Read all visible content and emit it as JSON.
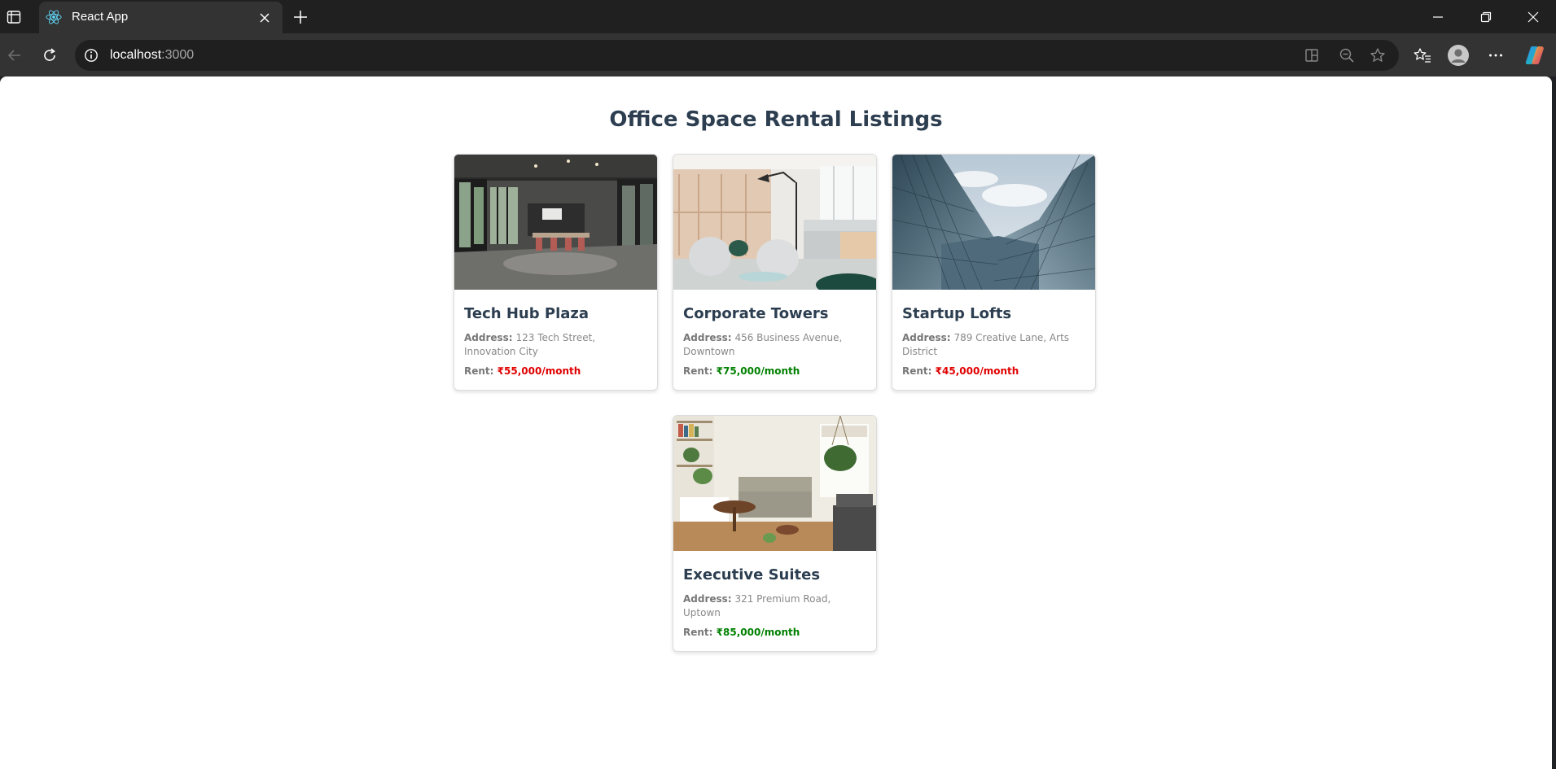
{
  "browser": {
    "tab_title": "React App",
    "url_host": "localhost",
    "url_port": ":3000",
    "icons": [
      "sidebar-toggle-icon",
      "react-logo-icon",
      "close-icon",
      "plus-icon",
      "minimize-icon",
      "restore-icon",
      "back-icon",
      "refresh-icon",
      "info-icon",
      "app-available-icon",
      "zoom-out-icon",
      "star-icon",
      "favorites-icon",
      "profile-icon",
      "more-icon",
      "copilot-icon"
    ]
  },
  "page": {
    "title": "Office Space Rental Listings"
  },
  "labels": {
    "address": "Address:",
    "rent": "Rent:"
  },
  "listings": [
    {
      "name": "Tech Hub Plaza",
      "address": "123 Tech Street, Innovation City",
      "rent": "₹55,000/month",
      "rent_color": "#e00000",
      "image": "open-plan-office-photo"
    },
    {
      "name": "Corporate Towers",
      "address": "456 Business Avenue, Downtown",
      "rent": "₹75,000/month",
      "rent_color": "#008000",
      "image": "lounge-office-photo"
    },
    {
      "name": "Startup Lofts",
      "address": "789 Creative Lane, Arts District",
      "rent": "₹45,000/month",
      "rent_color": "#e00000",
      "image": "glass-building-photo"
    },
    {
      "name": "Executive Suites",
      "address": "321 Premium Road, Uptown",
      "rent": "₹85,000/month",
      "rent_color": "#008000",
      "image": "home-office-photo"
    }
  ]
}
